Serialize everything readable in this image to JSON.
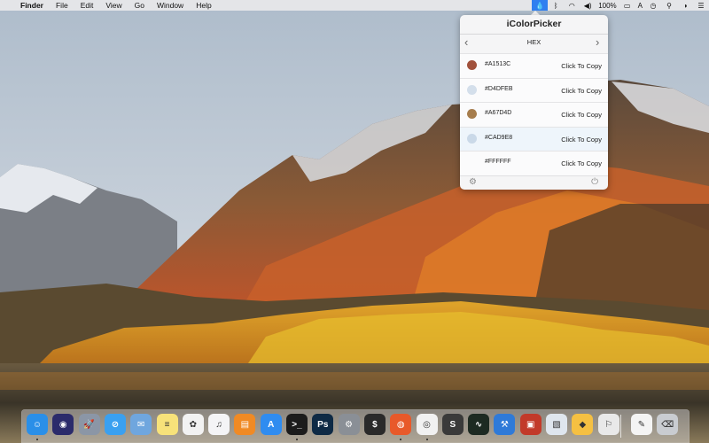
{
  "menubar": {
    "apple": "",
    "items": [
      "Finder",
      "File",
      "Edit",
      "View",
      "Go",
      "Window",
      "Help"
    ],
    "status": {
      "battery": "100%",
      "input_source": "A"
    }
  },
  "popover": {
    "title": "iColorPicker",
    "format": "HEX",
    "prev": "‹",
    "next": "›",
    "colors": [
      {
        "hex": "#A1513C",
        "action": "Click To Copy",
        "swatch": "#A1513C"
      },
      {
        "hex": "#D4DFEB",
        "action": "Click To Copy",
        "swatch": "#D4DFEB"
      },
      {
        "hex": "#A67D4D",
        "action": "Click To Copy",
        "swatch": "#A67D4D"
      },
      {
        "hex": "#CAD9E8",
        "action": "Click To Copy",
        "swatch": "#CAD9E8"
      },
      {
        "hex": "#FFFFFF",
        "action": "Click To Copy",
        "swatch": "#FFFFFF"
      }
    ],
    "footer_icons": [
      "gear-icon",
      "power-icon"
    ]
  },
  "dock": {
    "apps": [
      {
        "name": "finder",
        "icon": "finder-icon",
        "color": "#2a8fe8",
        "glyph": "☺",
        "running": true
      },
      {
        "name": "siri",
        "icon": "siri-icon",
        "color": "#2b2b6b",
        "glyph": "◉",
        "running": false
      },
      {
        "name": "launchpad",
        "icon": "launchpad-icon",
        "color": "#8b96a6",
        "glyph": "🚀",
        "running": false
      },
      {
        "name": "safari",
        "icon": "safari-icon",
        "color": "#3aa0f0",
        "glyph": "⊘",
        "running": false
      },
      {
        "name": "mail",
        "icon": "mail-icon",
        "color": "#6fa6de",
        "glyph": "✉",
        "running": false
      },
      {
        "name": "notes",
        "icon": "notes-icon",
        "color": "#f7e27a",
        "glyph": "≡",
        "running": false
      },
      {
        "name": "photos",
        "icon": "photos-icon",
        "color": "#f2f2f2",
        "glyph": "✿",
        "running": false
      },
      {
        "name": "itunes",
        "icon": "itunes-icon",
        "color": "#f4f4f6",
        "glyph": "♫",
        "running": false
      },
      {
        "name": "ibooks",
        "icon": "ibooks-icon",
        "color": "#f08a24",
        "glyph": "▤",
        "running": false
      },
      {
        "name": "app-store",
        "icon": "app-store-icon",
        "color": "#2f8cf0",
        "glyph": "A",
        "running": false
      },
      {
        "name": "terminal",
        "icon": "terminal-icon",
        "color": "#1c1c1c",
        "glyph": ">_",
        "running": true
      },
      {
        "name": "photoshop",
        "icon": "photoshop-icon",
        "color": "#0e2a45",
        "glyph": "Ps",
        "running": false
      },
      {
        "name": "system-preferences",
        "icon": "system-preferences-icon",
        "color": "#8a8f96",
        "glyph": "⚙",
        "running": false
      },
      {
        "name": "console",
        "icon": "console-icon",
        "color": "#2a2a2a",
        "glyph": "$",
        "running": false
      },
      {
        "name": "firefox",
        "icon": "firefox-icon",
        "color": "#e8592a",
        "glyph": "◍",
        "running": true
      },
      {
        "name": "chrome",
        "icon": "chrome-icon",
        "color": "#f1f1f1",
        "glyph": "◎",
        "running": true
      },
      {
        "name": "sublime-text",
        "icon": "sublime-text-icon",
        "color": "#3a3a3a",
        "glyph": "S",
        "running": false
      },
      {
        "name": "activity-monitor",
        "icon": "activity-monitor-icon",
        "color": "#1d2a22",
        "glyph": "∿",
        "running": false
      },
      {
        "name": "xcode",
        "icon": "xcode-icon",
        "color": "#2f7ad8",
        "glyph": "⚒",
        "running": false
      },
      {
        "name": "cardhop",
        "icon": "cardhop-icon",
        "color": "#c23a2a",
        "glyph": "▣",
        "running": false
      },
      {
        "name": "preview",
        "icon": "preview-icon",
        "color": "#dfe6ee",
        "glyph": "▧",
        "running": false
      },
      {
        "name": "sketch",
        "icon": "sketch-icon",
        "color": "#f5c042",
        "glyph": "◆",
        "running": false
      },
      {
        "name": "instruments",
        "icon": "instruments-icon",
        "color": "#e9e9e9",
        "glyph": "⚐",
        "running": false
      },
      {
        "name": "document",
        "icon": "document-icon",
        "color": "#f4f4f4",
        "glyph": "✎",
        "running": false
      },
      {
        "name": "trash",
        "icon": "trash-icon",
        "color": "#c9ccd1",
        "glyph": "⌫",
        "running": false
      }
    ]
  }
}
